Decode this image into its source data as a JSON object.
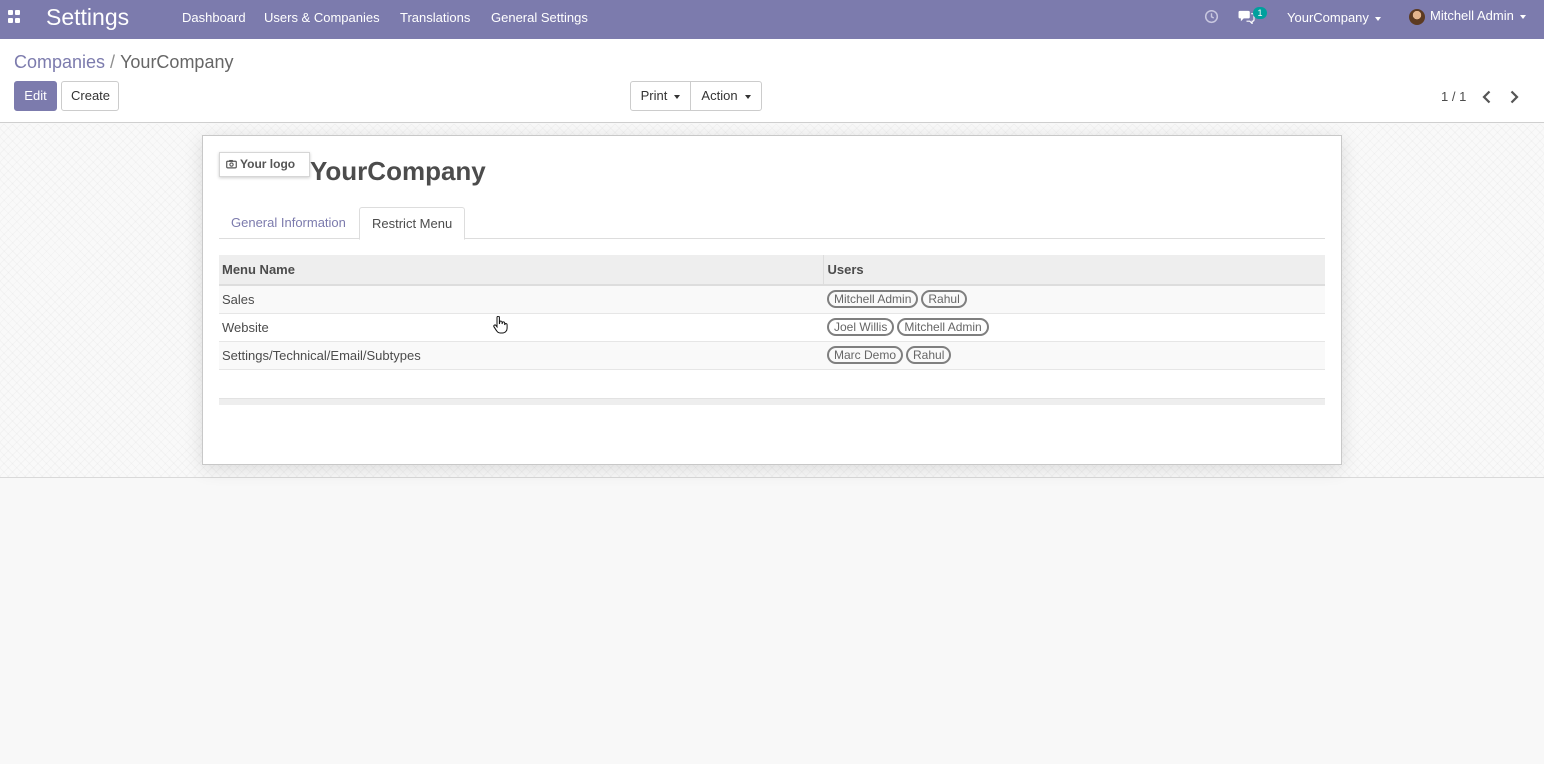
{
  "navbar": {
    "app_title": "Settings",
    "menu": [
      "Dashboard",
      "Users & Companies",
      "Translations",
      "General Settings"
    ],
    "chat_badge": "1",
    "company": "YourCompany",
    "user": "Mitchell Admin",
    "colors": {
      "brand": "#7c7bad",
      "badge": "#00a09d"
    }
  },
  "breadcrumb": {
    "parent": "Companies",
    "separator": "/",
    "current": "YourCompany"
  },
  "buttons": {
    "edit": "Edit",
    "create": "Create",
    "print": "Print",
    "action": "Action"
  },
  "pager": {
    "value": "1 / 1"
  },
  "form": {
    "logo_placeholder": "Your logo",
    "company_name": "YourCompany",
    "tabs": [
      {
        "label": "General Information",
        "active": false
      },
      {
        "label": "Restrict Menu",
        "active": true
      }
    ],
    "restrict_table": {
      "columns": [
        "Menu Name",
        "Users"
      ],
      "rows": [
        {
          "menu": "Sales",
          "users": [
            "Mitchell Admin",
            "Rahul"
          ]
        },
        {
          "menu": "Website",
          "users": [
            "Joel Willis",
            "Mitchell Admin"
          ]
        },
        {
          "menu": "Settings/Technical/Email/Subtypes",
          "users": [
            "Marc Demo",
            "Rahul"
          ]
        }
      ]
    }
  },
  "icons": [
    "apps-grid-icon",
    "clock-icon",
    "chat-icon",
    "camera-icon",
    "chevron-left-icon",
    "chevron-right-icon",
    "hand-pointer-icon"
  ]
}
